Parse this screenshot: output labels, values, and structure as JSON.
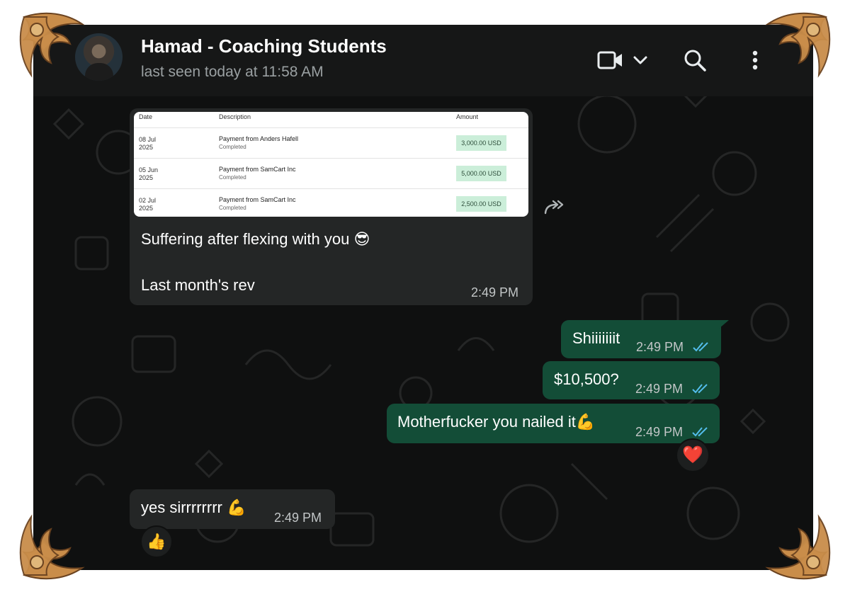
{
  "header": {
    "title": "Hamad - Coaching Students",
    "subtitle": "last seen today at 11:58 AM"
  },
  "messages": {
    "m1": {
      "receipt": {
        "columns": [
          "Date",
          "Description",
          "Amount"
        ],
        "rows": [
          {
            "date_day": "08 Jul",
            "date_year": "2025",
            "description": "Payment from Anders Hafell",
            "status": "Completed",
            "amount": "3,000.00 USD"
          },
          {
            "date_day": "05 Jun",
            "date_year": "2025",
            "description": "Payment from SamCart  Inc",
            "status": "Completed",
            "amount": "5,000.00 USD"
          },
          {
            "date_day": "02 Jul",
            "date_year": "2025",
            "description": "Payment from SamCart  Inc",
            "status": "Completed",
            "amount": "2,500.00 USD"
          }
        ]
      },
      "line1": "Suffering after flexing with you",
      "line1_emoji": "😎",
      "line2": "Last month's rev",
      "time": "2:49 PM"
    },
    "m2": {
      "text": "Shiiiiiiit",
      "time": "2:49 PM"
    },
    "m3": {
      "text": "$10,500?",
      "time": "2:49 PM"
    },
    "m4": {
      "text": "Motherfucker you nailed it",
      "emoji": "💪",
      "time": "2:49 PM",
      "reaction": "❤️"
    },
    "m5": {
      "text": "yes sirrrrrrrr",
      "emoji": "💪",
      "time": "2:49 PM",
      "reaction": "👍"
    }
  },
  "colors": {
    "background": "#0f1010",
    "header": "#161717",
    "incoming_bubble": "#242626",
    "outgoing_bubble": "#134d37",
    "read_ticks": "#53bdeb",
    "frame_ornament": "#c98d4a"
  },
  "icons": [
    "video-call-icon",
    "chevron-down-icon",
    "search-icon",
    "menu-dots-icon",
    "forward-icon",
    "read-ticks-icon"
  ]
}
